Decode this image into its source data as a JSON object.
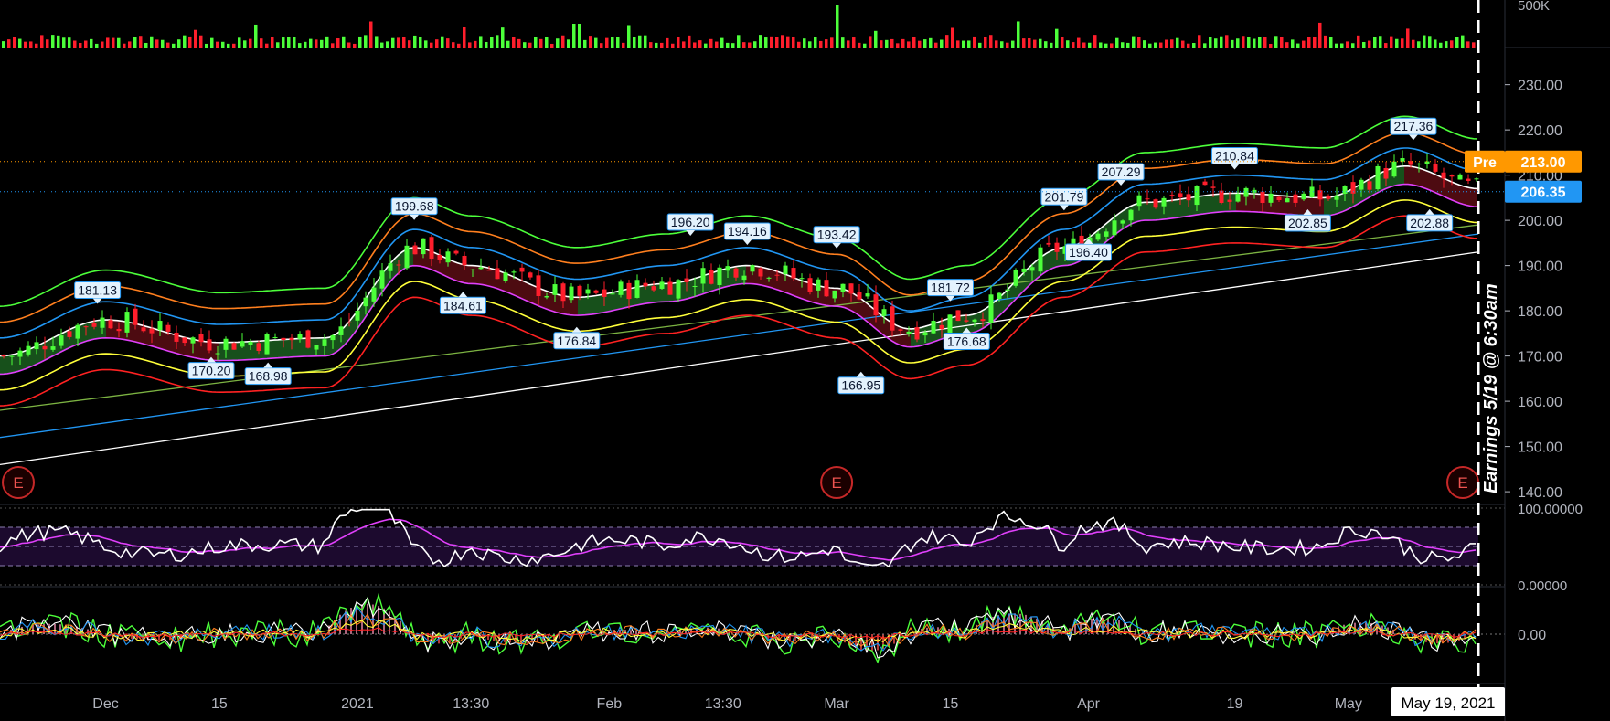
{
  "chart_data": {
    "type": "candlestick",
    "price_axis": {
      "ticks": [
        "230.00",
        "220.00",
        "210.00",
        "200.00",
        "190.00",
        "180.00",
        "170.00",
        "160.00",
        "150.00",
        "140.00"
      ],
      "tick_values": [
        230,
        220,
        210,
        200,
        190,
        180,
        170,
        160,
        150,
        140
      ],
      "range": [
        138,
        237
      ]
    },
    "volume_axis": {
      "tick": "500K",
      "value": 500000
    },
    "x_axis": {
      "labels": [
        {
          "text": "Dec",
          "date": "2020-12-01"
        },
        {
          "text": "15",
          "date": "2020-12-15"
        },
        {
          "text": "2021",
          "date": "2021-01-01"
        },
        {
          "text": "13:30",
          "date": "2021-01-15"
        },
        {
          "text": "Feb",
          "date": "2021-02-01"
        },
        {
          "text": "13:30",
          "date": "2021-02-15"
        },
        {
          "text": "Mar",
          "date": "2021-03-01"
        },
        {
          "text": "15",
          "date": "2021-03-15"
        },
        {
          "text": "Apr",
          "date": "2021-04-01"
        },
        {
          "text": "19",
          "date": "2021-04-19"
        },
        {
          "text": "May",
          "date": "2021-05-03"
        }
      ],
      "range": [
        "2020-11-18",
        "2021-05-19"
      ],
      "current_date_label": "May 19, 2021"
    },
    "price_labels": {
      "premarket": {
        "label": "Pre",
        "value": "213.00",
        "color": "#ff9800"
      },
      "last": {
        "value": "206.35",
        "color": "#2196f3"
      }
    },
    "swing_labels": [
      {
        "text": "181.13",
        "date": "2020-11-30",
        "value": 181.13,
        "type": "high"
      },
      {
        "text": "170.20",
        "date": "2020-12-14",
        "value": 170.2,
        "type": "low"
      },
      {
        "text": "168.98",
        "date": "2020-12-21",
        "value": 168.98,
        "type": "low"
      },
      {
        "text": "199.68",
        "date": "2021-01-08",
        "value": 199.68,
        "type": "high"
      },
      {
        "text": "184.61",
        "date": "2021-01-14",
        "value": 184.61,
        "type": "low"
      },
      {
        "text": "176.84",
        "date": "2021-01-28",
        "value": 176.84,
        "type": "low"
      },
      {
        "text": "196.20",
        "date": "2021-02-11",
        "value": 196.2,
        "type": "high"
      },
      {
        "text": "194.16",
        "date": "2021-02-18",
        "value": 194.16,
        "type": "high"
      },
      {
        "text": "193.42",
        "date": "2021-03-01",
        "value": 193.42,
        "type": "high"
      },
      {
        "text": "166.95",
        "date": "2021-03-04",
        "value": 166.95,
        "type": "low"
      },
      {
        "text": "181.72",
        "date": "2021-03-15",
        "value": 181.72,
        "type": "high"
      },
      {
        "text": "176.68",
        "date": "2021-03-17",
        "value": 176.68,
        "type": "low"
      },
      {
        "text": "201.79",
        "date": "2021-03-29",
        "value": 201.79,
        "type": "high"
      },
      {
        "text": "196.40",
        "date": "2021-04-01",
        "value": 196.4,
        "type": "low"
      },
      {
        "text": "207.29",
        "date": "2021-04-05",
        "value": 207.29,
        "type": "high"
      },
      {
        "text": "210.84",
        "date": "2021-04-19",
        "value": 210.84,
        "type": "high"
      },
      {
        "text": "202.85",
        "date": "2021-04-28",
        "value": 202.85,
        "type": "low"
      },
      {
        "text": "217.36",
        "date": "2021-05-11",
        "value": 217.36,
        "type": "high"
      },
      {
        "text": "202.88",
        "date": "2021-05-13",
        "value": 202.88,
        "type": "low"
      }
    ],
    "earnings_markers": [
      {
        "text": "E",
        "date": "2020-11-18"
      },
      {
        "text": "E",
        "date": "2021-03-01"
      },
      {
        "text": "E",
        "date": "2021-05-19"
      }
    ],
    "earnings_note": "Earnings 5/19 @ 6:30am",
    "oscillator": {
      "ticks": [
        "100.00000",
        "0.00000"
      ],
      "tick_values": [
        100,
        0
      ],
      "bands": [
        75,
        50,
        25
      ]
    },
    "histogram": {
      "ticks": [
        "0.00"
      ],
      "tick_values": [
        0
      ]
    },
    "bands": {
      "center_anchors": [
        [
          "2020-11-18",
          170
        ],
        [
          "2020-12-01",
          178
        ],
        [
          "2020-12-15",
          173
        ],
        [
          "2020-12-28",
          174
        ],
        [
          "2021-01-08",
          194
        ],
        [
          "2021-01-15",
          190
        ],
        [
          "2021-01-28",
          183
        ],
        [
          "2021-02-08",
          186
        ],
        [
          "2021-02-18",
          190
        ],
        [
          "2021-03-01",
          185
        ],
        [
          "2021-03-10",
          176
        ],
        [
          "2021-03-17",
          179
        ],
        [
          "2021-03-29",
          194
        ],
        [
          "2021-04-08",
          204
        ],
        [
          "2021-04-19",
          206
        ],
        [
          "2021-04-30",
          205
        ],
        [
          "2021-05-10",
          212
        ],
        [
          "2021-05-19",
          207
        ]
      ],
      "offsets": [
        11,
        7.5,
        4,
        0,
        -4,
        -7.5,
        -11
      ],
      "colors": [
        "#4cff3a",
        "#ff7f1e",
        "#2196f3",
        "#ffffff",
        "#e040fb",
        "#ffff3a",
        "#ff2222"
      ],
      "trend_lines": [
        {
          "name": "",
          "color": "#2196f3",
          "start": [
            "2020-11-18",
            152
          ],
          "end": [
            "2021-05-19",
            197
          ]
        },
        {
          "name": "",
          "color": "#ffffff",
          "start": [
            "2020-11-18",
            146
          ],
          "end": [
            "2021-05-19",
            193
          ]
        },
        {
          "name": "",
          "color": "#7cb342",
          "start": [
            "2020-11-18",
            158
          ],
          "end": [
            "2021-05-19",
            199
          ]
        }
      ]
    },
    "colors": {
      "up": "#4cff3a",
      "down": "#ff1e2c",
      "background": "#000000",
      "axis_text": "#b2b5be"
    },
    "grid": false
  }
}
